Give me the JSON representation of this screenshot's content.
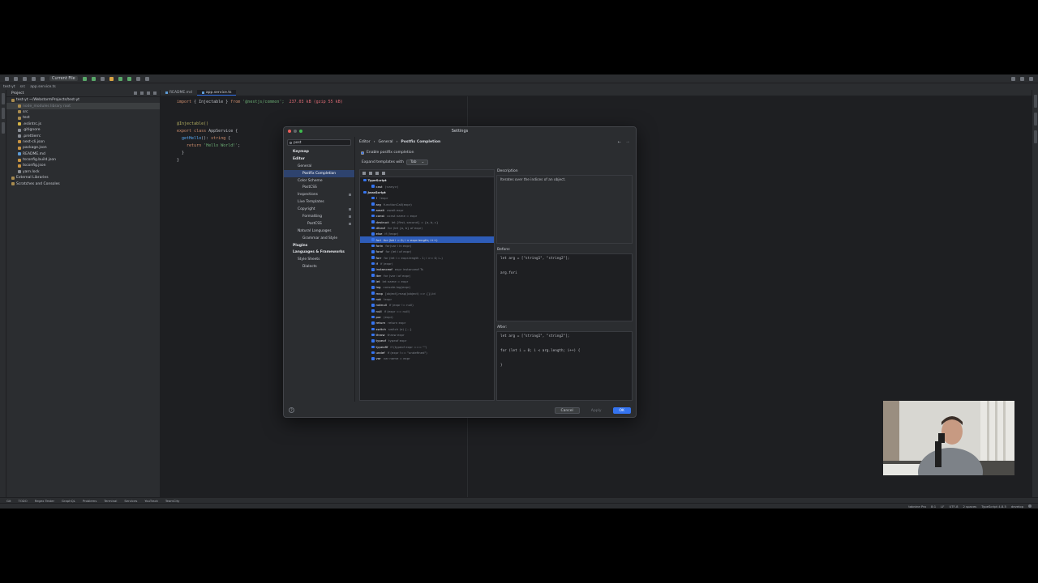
{
  "toolbar": {
    "run_config": "Current File"
  },
  "breadcrumb": [
    "test-yt",
    "src",
    "app.service.ts"
  ],
  "project": {
    "title": "Project",
    "items": [
      {
        "label": "test-yt  ~/WebstormProjects/test-yt",
        "indent": 0,
        "kind": "folder"
      },
      {
        "label": "node_modules  library root",
        "indent": 1,
        "kind": "folder",
        "selected": true
      },
      {
        "label": "src",
        "indent": 1,
        "kind": "folder"
      },
      {
        "label": "test",
        "indent": 1,
        "kind": "folder"
      },
      {
        "label": ".eslintrc.js",
        "indent": 1,
        "kind": "js"
      },
      {
        "label": ".gitignore",
        "indent": 1,
        "kind": "file"
      },
      {
        "label": ".prettierrc",
        "indent": 1,
        "kind": "file"
      },
      {
        "label": "nest-cli.json",
        "indent": 1,
        "kind": "json"
      },
      {
        "label": "package.json",
        "indent": 1,
        "kind": "json"
      },
      {
        "label": "README.md",
        "indent": 1,
        "kind": "md"
      },
      {
        "label": "tsconfig.build.json",
        "indent": 1,
        "kind": "json"
      },
      {
        "label": "tsconfig.json",
        "indent": 1,
        "kind": "json"
      },
      {
        "label": "yarn.lock",
        "indent": 1,
        "kind": "file"
      },
      {
        "label": "External Libraries",
        "indent": 0,
        "kind": "folder"
      },
      {
        "label": "Scratches and Consoles",
        "indent": 0,
        "kind": "folder"
      }
    ]
  },
  "editor": {
    "tabs": [
      {
        "label": "README.md",
        "active": false
      },
      {
        "label": "app.service.ts",
        "active": true
      }
    ],
    "lines": [
      {
        "parts": [
          {
            "t": "import",
            "c": "kw"
          },
          {
            "t": " { Injectable } ",
            "c": ""
          },
          {
            "t": "from",
            "c": "kw"
          },
          {
            "t": " '@nestjs/common';",
            "c": "str"
          },
          {
            "t": "  237.03 kB (gzip 55 kB)",
            "c": "hint"
          }
        ]
      },
      {
        "parts": []
      },
      {
        "parts": []
      },
      {
        "parts": [
          {
            "t": "@Injectable()",
            "c": "ann"
          }
        ]
      },
      {
        "parts": [
          {
            "t": "export class",
            "c": "kw"
          },
          {
            "t": " AppService {",
            "c": ""
          }
        ]
      },
      {
        "parts": [
          {
            "t": "  getHello",
            "c": "fn"
          },
          {
            "t": "(): ",
            "c": ""
          },
          {
            "t": "string",
            "c": "kw"
          },
          {
            "t": " {",
            "c": ""
          }
        ]
      },
      {
        "parts": [
          {
            "t": "    return",
            "c": "kw"
          },
          {
            "t": " 'Hello World!'",
            "c": "str"
          },
          {
            "t": ";",
            "c": ""
          }
        ]
      },
      {
        "parts": [
          {
            "t": "  }",
            "c": ""
          }
        ]
      },
      {
        "parts": [
          {
            "t": "}",
            "c": ""
          }
        ]
      },
      {
        "parts": []
      }
    ]
  },
  "settings": {
    "title": "Settings",
    "search": "post",
    "nav": [
      {
        "label": "Keymap",
        "indent": 0,
        "bold": true
      },
      {
        "label": "Editor",
        "indent": 0,
        "bold": true
      },
      {
        "label": "General",
        "indent": 1
      },
      {
        "label": "Postfix Completion",
        "indent": 2,
        "selected": true
      },
      {
        "label": "Color Scheme",
        "indent": 1
      },
      {
        "label": "PostCSS",
        "indent": 2
      },
      {
        "label": "Inspections",
        "indent": 1,
        "badge": true
      },
      {
        "label": "Live Templates",
        "indent": 1
      },
      {
        "label": "Copyright",
        "indent": 1,
        "badge": true
      },
      {
        "label": "Formatting",
        "indent": 2,
        "badge": true
      },
      {
        "label": "PostCSS",
        "indent": 3,
        "badge": true
      },
      {
        "label": "Natural Languages",
        "indent": 1
      },
      {
        "label": "Grammar and Style",
        "indent": 2
      },
      {
        "label": "Plugins",
        "indent": 0,
        "bold": true
      },
      {
        "label": "Languages & Frameworks",
        "indent": 0,
        "bold": true
      },
      {
        "label": "Style Sheets",
        "indent": 1
      },
      {
        "label": "Dialects",
        "indent": 2
      }
    ],
    "crumb": [
      "Editor",
      "General",
      "Postfix Completion"
    ],
    "enable_label": "Enable postfix completion",
    "expand_label": "Expand templates with",
    "expand_value": "Tab",
    "templates": [
      {
        "name": "TypeScript",
        "desc": "",
        "group": true,
        "indent": 0
      },
      {
        "name": "cast",
        "desc": "(<any>)",
        "indent": 1
      },
      {
        "name": "JavaScript",
        "desc": "",
        "group": true,
        "indent": 0
      },
      {
        "name": "!",
        "desc": "!expr",
        "indent": 1
      },
      {
        "name": "arg",
        "desc": "functionCall(expr)",
        "indent": 1
      },
      {
        "name": "await",
        "desc": "await expr",
        "indent": 1
      },
      {
        "name": "const",
        "desc": "const name = expr",
        "indent": 1
      },
      {
        "name": "destruct",
        "desc": "let {first, second} = {a, b, c}",
        "indent": 1
      },
      {
        "name": "dforof",
        "desc": "for (let {a, b} of expr)",
        "indent": 1
      },
      {
        "name": "else",
        "desc": "if (!expr)",
        "indent": 1
      },
      {
        "name": "fori",
        "desc": "for (let i = 0; i < expr.length; i++)",
        "indent": 1,
        "selected": true
      },
      {
        "name": "forin",
        "desc": "for(var i in expr)",
        "indent": 1
      },
      {
        "name": "forof",
        "desc": "for (let i of expr)",
        "indent": 1
      },
      {
        "name": "forr",
        "desc": "for (let i = expr.length - 1; i >= 0; i--)",
        "indent": 1
      },
      {
        "name": "if",
        "desc": "if (expr)",
        "indent": 1
      },
      {
        "name": "instanceof",
        "desc": "expr instanceof Ts",
        "indent": 1
      },
      {
        "name": "iter",
        "desc": "for (var i of expr)",
        "indent": 1
      },
      {
        "name": "let",
        "desc": "let name = expr",
        "indent": 1
      },
      {
        "name": "log",
        "desc": "console.log(expr)",
        "indent": 1
      },
      {
        "name": "map",
        "desc": "[object].map((object) => {}).id",
        "indent": 1
      },
      {
        "name": "not",
        "desc": "!expr",
        "indent": 1
      },
      {
        "name": "notnull",
        "desc": "if (expr != null)",
        "indent": 1
      },
      {
        "name": "null",
        "desc": "if (expr == null)",
        "indent": 1
      },
      {
        "name": "par",
        "desc": "(expr)",
        "indent": 1
      },
      {
        "name": "return",
        "desc": "return expr",
        "indent": 1
      },
      {
        "name": "switch",
        "desc": "switch (e) {...}",
        "indent": 1
      },
      {
        "name": "throw",
        "desc": "throw expr",
        "indent": 1
      },
      {
        "name": "typeof",
        "desc": "typeof expr",
        "indent": 1
      },
      {
        "name": "typeofif",
        "desc": "if (typeof expr === \"\")",
        "indent": 1
      },
      {
        "name": "undef",
        "desc": "if (expr !== \"undefined\")",
        "indent": 1
      },
      {
        "name": "var",
        "desc": "var name = expr",
        "indent": 1
      }
    ],
    "description_label": "Description",
    "description_text": "Iterates over the indices of an object.",
    "before_label": "Before:",
    "before_code": "let arg = [\"string1\", \"string2\"];\n\n\narg.fori",
    "after_label": "After:",
    "after_code": "let arg = [\"string1\", \"string2\"];\n\n\nfor (let i = 0; i < arg.length; i++) {\n\n\n}",
    "buttons": {
      "cancel": "Cancel",
      "apply": "Apply",
      "ok": "OK"
    }
  },
  "statusbar": {
    "left": [
      "Git",
      "TODO",
      "Regex Tester",
      "GraphQL",
      "Problems",
      "Terminal",
      "Services",
      "YouTrack",
      "TeamCity"
    ],
    "right": [
      "tabnine Pro",
      "8:1",
      "LF",
      "UTF-8",
      "2 spaces",
      "TypeScript 4.8.5",
      "develop"
    ]
  },
  "colors": {
    "accent": "#3574f0",
    "background": "#2b2d30",
    "editor": "#1e1f22"
  }
}
